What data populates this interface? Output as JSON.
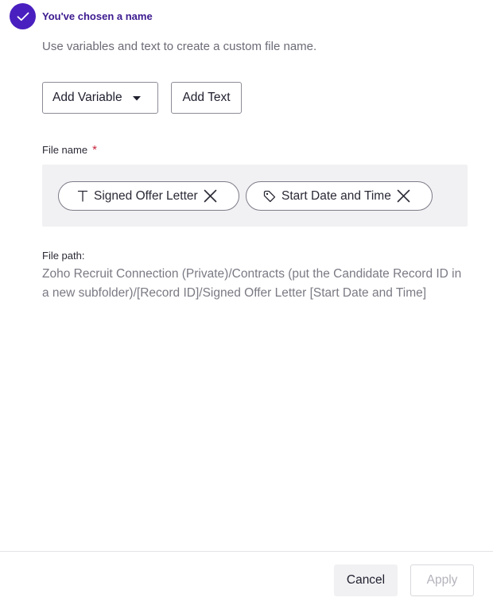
{
  "step": {
    "title": "You've chosen a name",
    "icon": "check-icon",
    "accent_color": "#4a1fbf"
  },
  "subtitle": "Use variables and text to create a custom file name.",
  "toolbar": {
    "add_variable_label": "Add Variable",
    "add_text_label": "Add Text"
  },
  "file_name": {
    "label": "File name",
    "required_marker": "*",
    "chips": [
      {
        "type": "text",
        "icon": "text-type-icon",
        "label": "Signed Offer Letter"
      },
      {
        "type": "variable",
        "icon": "tag-icon",
        "label": "Start Date and Time"
      }
    ]
  },
  "file_path": {
    "label": "File path:",
    "value": "Zoho Recruit Connection (Private)/Contracts (put the Candidate Record ID in a new subfolder)/[Record ID]/Signed Offer Letter [Start Date and Time]"
  },
  "footer": {
    "cancel_label": "Cancel",
    "apply_label": "Apply"
  }
}
